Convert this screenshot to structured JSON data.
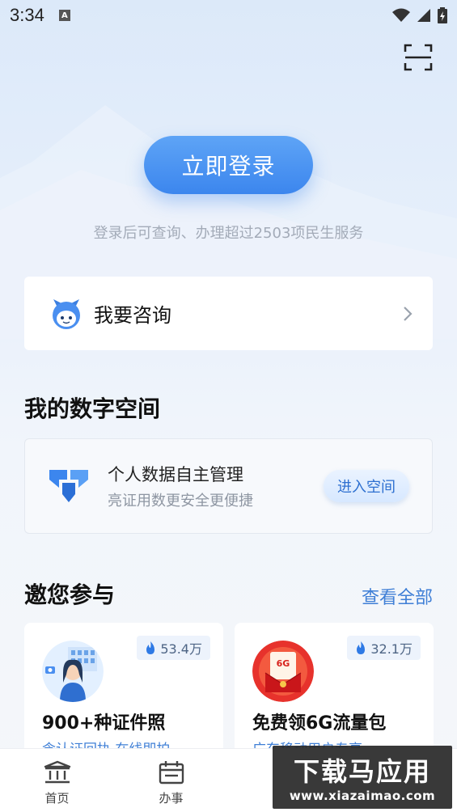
{
  "status_bar": {
    "time": "3:34",
    "notification_letter": "A"
  },
  "login": {
    "button_label": "立即登录",
    "subtitle": "登录后可查询、办理超过2503项民生服务"
  },
  "consult": {
    "label": "我要咨询"
  },
  "digital_space": {
    "section_title": "我的数字空间",
    "title": "个人数据自主管理",
    "subtitle": "亮证用数更安全更便捷",
    "enter_label": "进入空间"
  },
  "participate": {
    "section_title": "邀您参与",
    "view_all_label": "查看全部",
    "cards": [
      {
        "title": "900+种证件照",
        "subtitle": "含认证回执 在线即拍",
        "count": "53.4万",
        "icon": "id-photo-illustration"
      },
      {
        "title": "免费领6G流量包",
        "subtitle": "广东移动用户专享",
        "count": "32.1万",
        "icon": "data-package-envelope"
      }
    ]
  },
  "bottom_nav": {
    "items": [
      {
        "label": "首页",
        "icon": "home-building-icon"
      },
      {
        "label": "办事",
        "icon": "calendar-icon"
      }
    ]
  },
  "watermark": {
    "main": "下载马应用",
    "sub": "www.xiazaimao.com"
  },
  "colors": {
    "primary": "#3c86ee",
    "link": "#3f7fd6",
    "accent_fire": "#2f7ae5"
  }
}
